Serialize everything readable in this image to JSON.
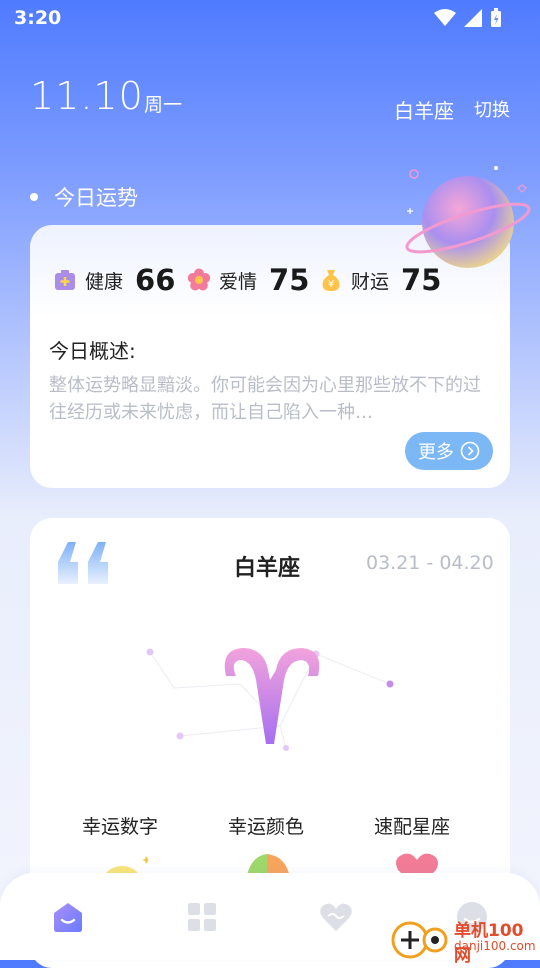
{
  "status_bar": {
    "time": "3:20"
  },
  "header": {
    "date": "11.10",
    "weekday": "周一",
    "sign": "白羊座",
    "switch_label": "切换"
  },
  "fortune": {
    "section_title": "今日运势",
    "stats": [
      {
        "label": "健康",
        "value": "66",
        "icon": "health-kit-icon"
      },
      {
        "label": "爱情",
        "value": "75",
        "icon": "flower-icon"
      },
      {
        "label": "财运",
        "value": "75",
        "icon": "money-bag-icon"
      }
    ],
    "overview_title": "今日概述:",
    "overview_text": "整体运势略显黯淡。你可能会因为心里那些放不下的过往经历或未来忧虑，而让自己陷入一种…",
    "more_label": "更多"
  },
  "sign_card": {
    "title": "白羊座",
    "dates": "03.21 - 04.20",
    "lucky": [
      {
        "label": "幸运数字"
      },
      {
        "label": "幸运颜色"
      },
      {
        "label": "速配星座"
      }
    ]
  },
  "bottom_nav": {
    "items": [
      {
        "icon": "home-icon"
      },
      {
        "icon": "grid-icon"
      },
      {
        "icon": "heart-icon"
      },
      {
        "icon": "profile-icon"
      }
    ]
  },
  "watermark": {
    "title": "单机100网",
    "url": "danji100.com"
  },
  "colors": {
    "accent": "#4f7bff",
    "more_button": "#7cb7f6",
    "purple": "#b07be0"
  }
}
